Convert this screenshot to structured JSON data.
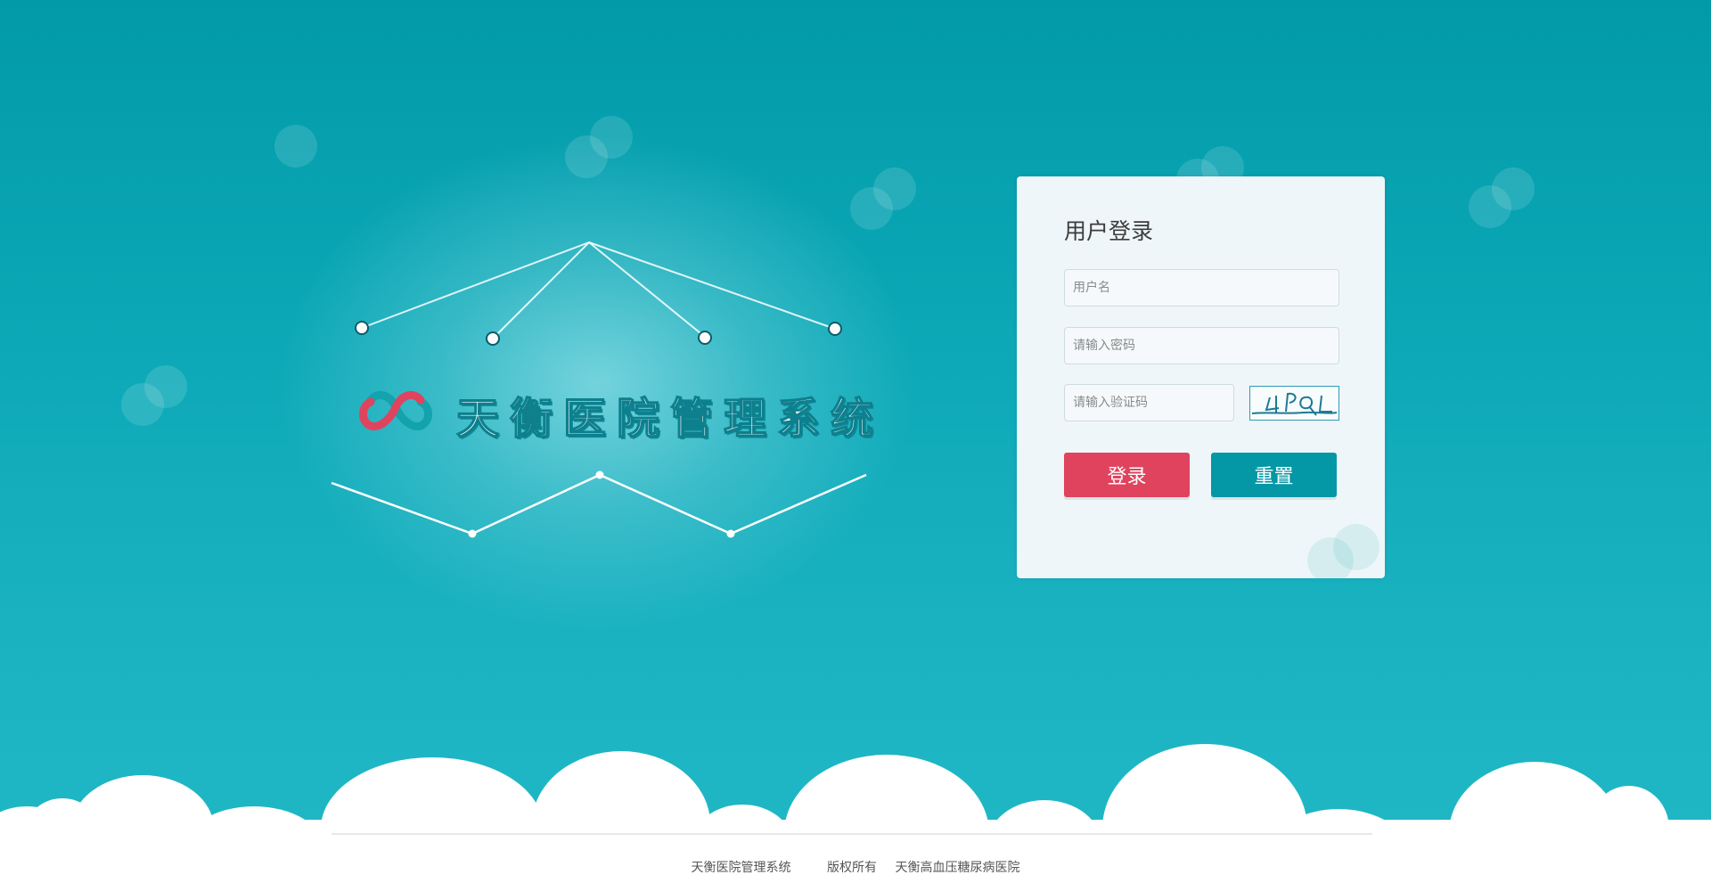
{
  "system": {
    "title": "天衡医院管理系统"
  },
  "login": {
    "heading": "用户登录",
    "username_placeholder": "用户名",
    "password_placeholder": "请输入密码",
    "captcha_placeholder": "请输入验证码",
    "captcha_text": "4PQ",
    "login_label": "登录",
    "reset_label": "重置"
  },
  "footer": {
    "system_name": "天衡医院管理系统",
    "copyright": "版权所有",
    "hospital": "天衡高血压糖尿病医院"
  },
  "colors": {
    "background_top": "#029aa9",
    "background_bottom": "#21b8c6",
    "login_button": "#e0435e",
    "reset_button": "#0497a5",
    "card_background": "#eff6f9"
  },
  "icons": {
    "logo": "heart-chain-logo"
  }
}
